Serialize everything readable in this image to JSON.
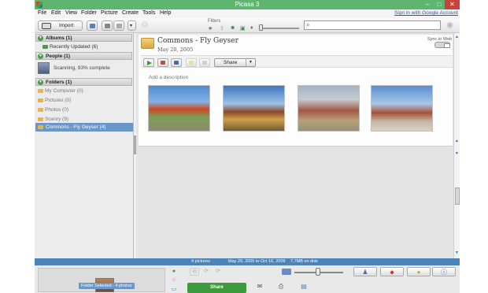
{
  "window": {
    "title": "Picasa 3"
  },
  "menu": {
    "items": [
      "File",
      "Edit",
      "View",
      "Folder",
      "Picture",
      "Create",
      "Tools",
      "Help"
    ],
    "signin": "Sign in with Google Account"
  },
  "toolbar": {
    "import_label": "Import",
    "filters_label": "Filters",
    "search_value": "",
    "filter_icons": [
      "star-icon",
      "upload-icon",
      "person-icon",
      "movie-icon",
      "geotag-icon"
    ]
  },
  "sidebar": {
    "albums_header": "Albums (1)",
    "albums": [
      {
        "label": "Recently Updated (6)"
      }
    ],
    "people_header": "People (1)",
    "people_status": "Scanning, 93% complete",
    "folders_header": "Folders (1)",
    "folders": [
      {
        "label": "My Computer (0)"
      },
      {
        "label": "Pictures (0)"
      },
      {
        "label": "Photos (0)"
      },
      {
        "label": "Scenry (9)"
      }
    ],
    "selected_folder": "Commons - Fly Geyser (4)"
  },
  "album": {
    "title": "Commons - Fly Geyser",
    "date": "May 20, 2005",
    "sync_label": "Sync to Web",
    "share_label": "Share",
    "add_description": "Add a description",
    "photos": [
      {
        "name": "fly-geyser-1"
      },
      {
        "name": "fly-geyser-2"
      },
      {
        "name": "fly-geyser-3"
      },
      {
        "name": "fly-geyser-4"
      }
    ]
  },
  "status": {
    "count": "4 pictures",
    "range": "May 20, 2005 to Oct 16, 2009",
    "size": "7.7MB on disk"
  },
  "tray": {
    "selection_label": "Folder Selected - 4 photos",
    "share_label": "Share"
  },
  "colors": {
    "titlebar": "#5fb56f",
    "selection": "#6c95c8",
    "statusbar": "#4c83b8",
    "share_green": "#3b9a3b"
  }
}
